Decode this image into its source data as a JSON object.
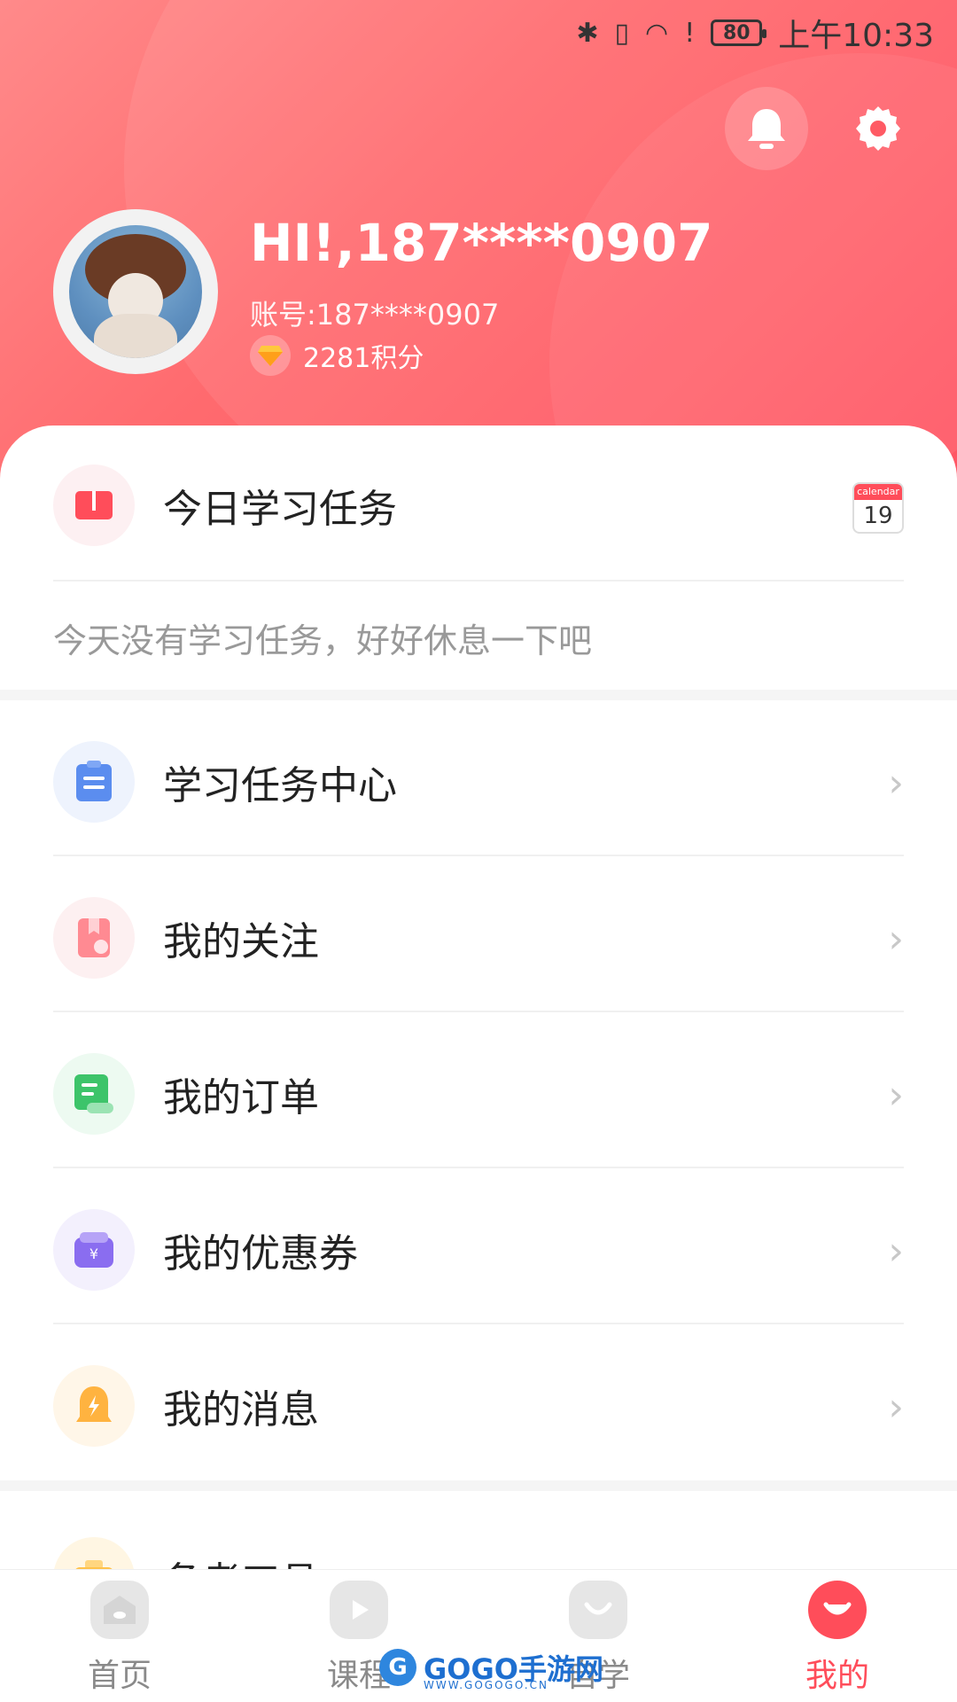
{
  "status_bar": {
    "battery": "80",
    "time": "上午10:33"
  },
  "profile": {
    "greeting": "HI!,187****0907",
    "account": "账号:187****0907",
    "points": "2281积分"
  },
  "task": {
    "title": "今日学习任务",
    "calendar_label": "calendar",
    "calendar_day": "19",
    "empty_text": "今天没有学习任务，好好休息一下吧"
  },
  "menu": [
    {
      "label": "学习任务中心",
      "icon": "clipboard-icon",
      "color": "#5b8def"
    },
    {
      "label": "我的关注",
      "icon": "bookmark-icon",
      "color": "#ff7b85"
    },
    {
      "label": "我的订单",
      "icon": "order-icon",
      "color": "#3dc46a"
    },
    {
      "label": "我的优惠券",
      "icon": "coupon-icon",
      "color": "#8a6df0"
    },
    {
      "label": "我的消息",
      "icon": "message-bell-icon",
      "color": "#ffb340"
    },
    {
      "label": "备考工具",
      "icon": "briefcase-icon",
      "color": "#ffc24a"
    }
  ],
  "bottom_nav": [
    {
      "label": "首页",
      "icon": "home-icon"
    },
    {
      "label": "课程",
      "icon": "play-icon"
    },
    {
      "label": "自学",
      "icon": "study-icon"
    },
    {
      "label": "我的",
      "icon": "profile-icon",
      "active": true
    }
  ],
  "watermark": {
    "text": "GOGO手游网",
    "sub": "WWW.GOGOGO.CN"
  },
  "colors": {
    "accent": "#ff4d5a",
    "header_start": "#ff8a8a",
    "header_end": "#ff4a5a"
  }
}
